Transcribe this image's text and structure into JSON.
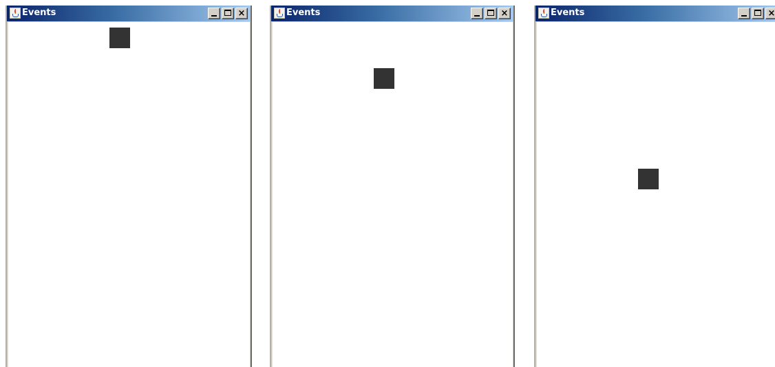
{
  "windows": [
    {
      "title": "Events",
      "icon": "java-cup-icon",
      "controls": {
        "minimize": "minimize-icon",
        "maximize": "maximize-icon",
        "close": "×"
      },
      "block_color": "#333333"
    },
    {
      "title": "Events",
      "icon": "java-cup-icon",
      "controls": {
        "minimize": "minimize-icon",
        "maximize": "maximize-icon",
        "close": "×"
      },
      "block_color": "#333333"
    },
    {
      "title": "Events",
      "icon": "java-cup-icon",
      "controls": {
        "minimize": "minimize-icon",
        "maximize": "maximize-icon",
        "close": "×"
      },
      "block_color": "#333333"
    }
  ],
  "colors": {
    "titlebar_start": "#0a246a",
    "titlebar_end": "#a6caf0",
    "canvas_bg": "#ffffff",
    "frame": "#d4d0c8"
  }
}
